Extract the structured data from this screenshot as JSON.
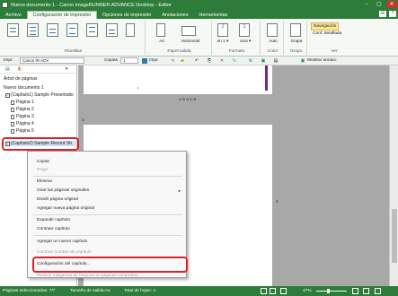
{
  "window": {
    "title": "Nuevo documento 1 - Canon imageRUNNER ADVANCE Desktop - Editor",
    "buttons": {
      "min": "–",
      "max": "▢",
      "close": "✕"
    }
  },
  "tabs": [
    {
      "label": "Archivo",
      "active": false
    },
    {
      "label": "Configuración de impresión",
      "active": true
    },
    {
      "label": "Opciones de impresión",
      "active": false
    },
    {
      "label": "Anotaciones",
      "active": false
    },
    {
      "label": "Herramientas",
      "active": false
    }
  ],
  "ribbon": {
    "groups": {
      "plantillas": "Plantillas",
      "papel_salida": "Papel salida",
      "formato": "Formato",
      "color": "Color",
      "grupo": "Grupo",
      "ver": "Ver"
    },
    "paper_size": "A4",
    "orientation": "Horizontal",
    "layout_value": "2",
    "layout_unit": "en 1 ▾",
    "copies_value": "1",
    "copies_unit": "cara ▾",
    "color_mode": "Auto",
    "staple": "Grapa",
    "nav_btn": "Navegación",
    "conf_btn": "Conf. detallada"
  },
  "toolbar": {
    "printer_label": "Impr.",
    "printer_value": "Canon iR-ADV",
    "copies_label": "Copias",
    "copies_value": "1",
    "print_label": "Impr.",
    "annotations_btn": "Mostrar anotac."
  },
  "left_pane": {
    "tree_title": "Árbol de páginas",
    "root": "Nuevo documento 1",
    "chapter1": "(Capítulo1) Sample Presentatio",
    "pages": [
      "Página 1",
      "Página 2",
      "Página 3",
      "Página 4",
      "Página 5"
    ],
    "chapter2": "(Capítulo2) Sample Record Sh"
  },
  "main": {
    "page_range": "1-5 a 1-6",
    "page_number": "2",
    "page_marker": "4"
  },
  "context_menu": {
    "items": [
      {
        "label": "Copiar",
        "disabled": false
      },
      {
        "label": "Pegar",
        "disabled": true
      },
      {
        "label": "Eliminar",
        "disabled": false
      },
      {
        "label": "Girar las páginas originales",
        "disabled": false,
        "submenu": true
      },
      {
        "label": "Dividir página original",
        "disabled": false
      },
      {
        "label": "Agregar nueva página original",
        "disabled": false
      },
      {
        "label": "Expandir capítulo",
        "disabled": false
      },
      {
        "label": "Contraer capítulo",
        "disabled": false
      },
      {
        "label": "Agregar un nuevo capítulo",
        "disabled": false
      },
      {
        "label": "Cambiar nombre de capítulo",
        "disabled": true
      },
      {
        "label": "Configuración del capítulo...",
        "disabled": false
      },
      {
        "label": "Reducir márgenes de bloques en páginas contraídas",
        "disabled": true
      }
    ],
    "submenu_arrow": "▸"
  },
  "status": {
    "selected": "Páginas seleccionadas: 7/7",
    "output_size": "Tamaño de salida:A4",
    "total_sheets": "Total de hojas: 4",
    "zoom": "47%"
  },
  "colors": {
    "accent": "#2d7c3a",
    "highlight": "#d9232a"
  }
}
